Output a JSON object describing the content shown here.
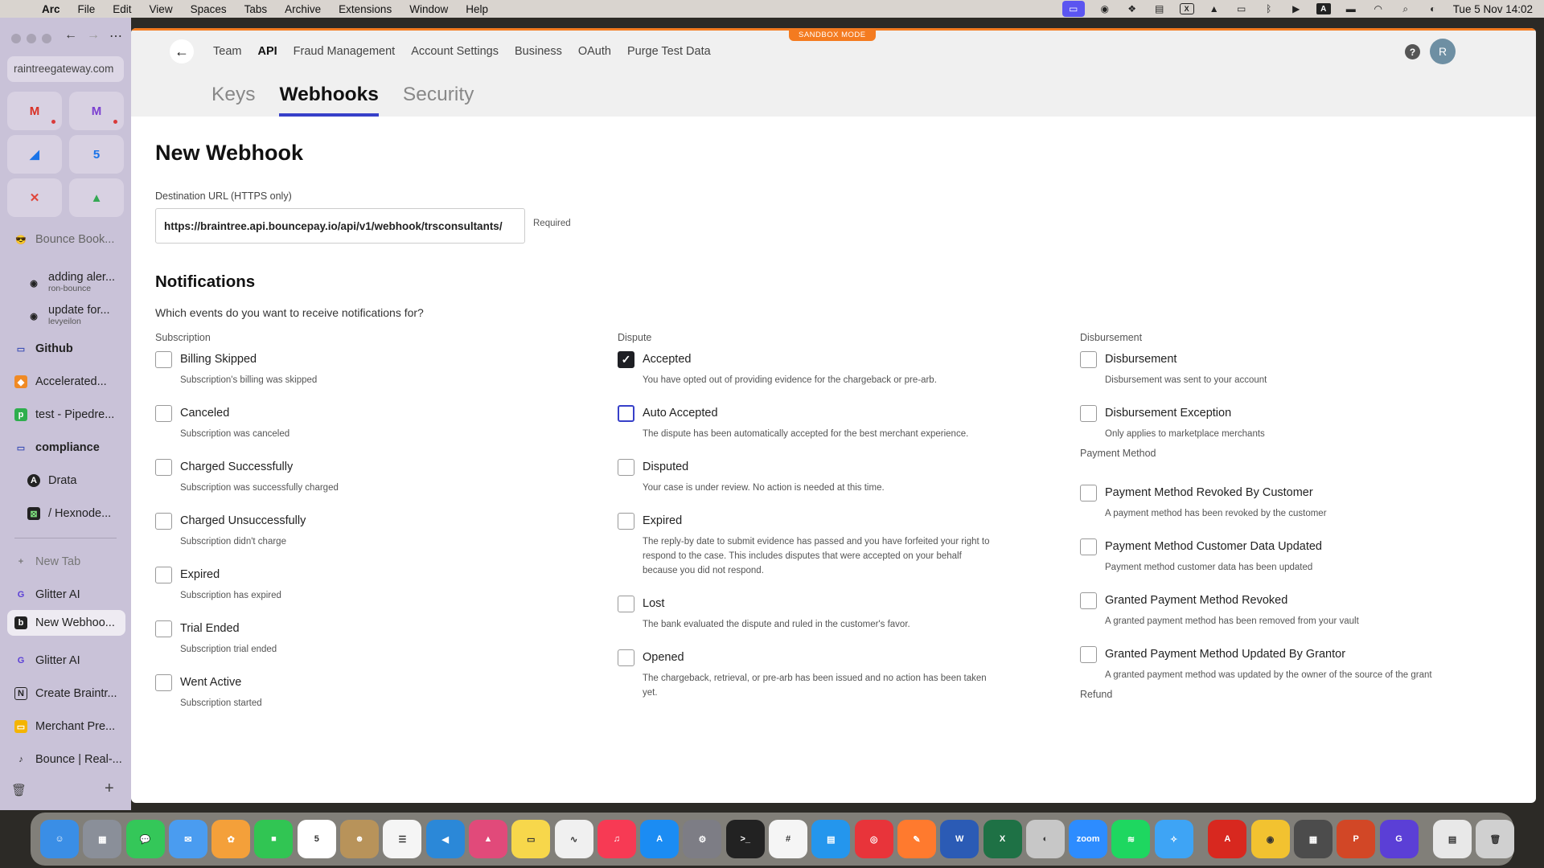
{
  "menubar": {
    "app": "Arc",
    "items": [
      "File",
      "Edit",
      "View",
      "Spaces",
      "Tabs",
      "Archive",
      "Extensions",
      "Window",
      "Help"
    ],
    "datetime": "Tue 5 Nov  14:02"
  },
  "sidebar": {
    "url": "raintreegateway.com",
    "favorites": [
      {
        "icon": "gmail-icon",
        "glyph": "M",
        "color": "#d93025"
      },
      {
        "icon": "gmail-icon",
        "glyph": "M",
        "color": "#7b3fd0"
      },
      {
        "icon": "drive-icon",
        "glyph": "◢",
        "color": "#1a73e8"
      },
      {
        "icon": "calendar-icon",
        "glyph": "5",
        "color": "#1a73e8"
      },
      {
        "icon": "close-x-icon",
        "glyph": "✕",
        "color": "#e0453a"
      },
      {
        "icon": "google-drive-icon",
        "glyph": "▲",
        "color": "#34a853"
      }
    ],
    "items": [
      {
        "label": "Bounce Book...",
        "kind": "muted"
      },
      {
        "label": "adding aler...",
        "sub": "ron-bounce"
      },
      {
        "label": "update for...",
        "sub": "levyeilon"
      },
      {
        "label": "Github"
      },
      {
        "label": "Accelerated..."
      },
      {
        "label": "test - Pipedre..."
      },
      {
        "label": "compliance"
      },
      {
        "label": "Drata"
      },
      {
        "label": "/ Hexnode..."
      },
      {
        "label": "New Tab"
      },
      {
        "label": "Glitter AI"
      },
      {
        "label": "New Webhoo..."
      },
      {
        "label": "Glitter AI"
      },
      {
        "label": "Create Braintr..."
      },
      {
        "label": "Merchant Pre..."
      },
      {
        "label": "Bounce | Real-..."
      }
    ]
  },
  "sandbox_label": "SANDBOX MODE",
  "topnav": {
    "links": [
      "Team",
      "API",
      "Fraud Management",
      "Account Settings",
      "Business",
      "OAuth",
      "Purge Test Data"
    ],
    "active": "API",
    "help": "?",
    "avatar": "R"
  },
  "subtabs": [
    "Keys",
    "Webhooks",
    "Security"
  ],
  "active_subtab": "Webhooks",
  "page": {
    "title": "New Webhook",
    "url_label": "Destination URL (HTTPS only)",
    "url_value": "https://braintree.api.bouncepay.io/api/v1/webhook/trsconsultants/",
    "required": "Required",
    "section_title": "Notifications",
    "section_desc": "Which events do you want to receive notifications for?"
  },
  "columns": [
    {
      "groups": [
        {
          "label": "Subscription",
          "events": [
            {
              "name": "Billing Skipped",
              "desc": "Subscription's billing was skipped",
              "checked": false
            },
            {
              "name": "Canceled",
              "desc": "Subscription was canceled",
              "checked": false
            },
            {
              "name": "Charged Successfully",
              "desc": "Subscription was successfully charged",
              "checked": false
            },
            {
              "name": "Charged Unsuccessfully",
              "desc": "Subscription didn't charge",
              "checked": false
            },
            {
              "name": "Expired",
              "desc": "Subscription has expired",
              "checked": false
            },
            {
              "name": "Trial Ended",
              "desc": "Subscription trial ended",
              "checked": false
            },
            {
              "name": "Went Active",
              "desc": "Subscription started",
              "checked": false
            }
          ]
        }
      ]
    },
    {
      "groups": [
        {
          "label": "Dispute",
          "events": [
            {
              "name": "Accepted",
              "desc": "You have opted out of providing evidence for the chargeback or pre-arb.",
              "checked": true
            },
            {
              "name": "Auto Accepted",
              "desc": "The dispute has been automatically accepted for the best merchant experience.",
              "checked": false,
              "focused": true
            },
            {
              "name": "Disputed",
              "desc": "Your case is under review. No action is needed at this time.",
              "checked": false
            },
            {
              "name": "Expired",
              "desc": "The reply-by date to submit evidence has passed and you have forfeited your right to respond to the case. This includes disputes that were accepted on your behalf because you did not respond.",
              "checked": false
            },
            {
              "name": "Lost",
              "desc": "The bank evaluated the dispute and ruled in the customer's favor.",
              "checked": false
            },
            {
              "name": "Opened",
              "desc": "The chargeback, retrieval, or pre-arb has been issued and no action has been taken yet.",
              "checked": false
            }
          ]
        }
      ]
    },
    {
      "groups": [
        {
          "label": "Disbursement",
          "events": [
            {
              "name": "Disbursement",
              "desc": "Disbursement was sent to your account",
              "checked": false
            },
            {
              "name": "Disbursement Exception",
              "desc": "Only applies to marketplace merchants",
              "checked": false
            }
          ]
        },
        {
          "label": "Payment Method",
          "events": [
            {
              "name": "Payment Method Revoked By Customer",
              "desc": "A payment method has been revoked by the customer",
              "checked": false
            },
            {
              "name": "Payment Method Customer Data Updated",
              "desc": "Payment method customer data has been updated",
              "checked": false
            },
            {
              "name": "Granted Payment Method Revoked",
              "desc": "A granted payment method has been removed from your vault",
              "checked": false
            },
            {
              "name": "Granted Payment Method Updated By Grantor",
              "desc": "A granted payment method was updated by the owner of the source of the grant",
              "checked": false
            }
          ]
        },
        {
          "label": "Refund",
          "events": []
        }
      ]
    }
  ],
  "dock": [
    {
      "name": "finder-icon",
      "glyph": "☺",
      "color": "#3a8ee6"
    },
    {
      "name": "launchpad-icon",
      "glyph": "▦",
      "color": "#8a8f99"
    },
    {
      "name": "messages-icon",
      "glyph": "💬",
      "color": "#34c759"
    },
    {
      "name": "mail-icon",
      "glyph": "✉",
      "color": "#4a9cf0"
    },
    {
      "name": "photos-icon",
      "glyph": "✿",
      "color": "#f4a03a"
    },
    {
      "name": "facetime-icon",
      "glyph": "■",
      "color": "#31c553"
    },
    {
      "name": "calendar-icon",
      "glyph": "5",
      "color": "#ffffff"
    },
    {
      "name": "contacts-icon",
      "glyph": "☻",
      "color": "#b8935a"
    },
    {
      "name": "reminders-icon",
      "glyph": "☰",
      "color": "#f5f5f5"
    },
    {
      "name": "vscode-icon",
      "glyph": "◀",
      "color": "#2b88d8"
    },
    {
      "name": "affinity-icon",
      "glyph": "▲",
      "color": "#e14a7a"
    },
    {
      "name": "notes-icon",
      "glyph": "▭",
      "color": "#f7d74b"
    },
    {
      "name": "freeform-icon",
      "glyph": "∿",
      "color": "#f0f0f0"
    },
    {
      "name": "music-icon",
      "glyph": "♫",
      "color": "#f73a54"
    },
    {
      "name": "appstore-icon",
      "glyph": "A",
      "color": "#1b8cf3"
    },
    {
      "name": "settings-icon",
      "glyph": "⚙",
      "color": "#7d7d85"
    },
    {
      "name": "terminal-icon",
      "glyph": ">_",
      "color": "#222222"
    },
    {
      "name": "slack-icon",
      "glyph": "#",
      "color": "#f5f5f5"
    },
    {
      "name": "docker-icon",
      "glyph": "▤",
      "color": "#2496ed"
    },
    {
      "name": "nord-icon",
      "glyph": "◎",
      "color": "#e8343a"
    },
    {
      "name": "pen-icon",
      "glyph": "✎",
      "color": "#ff7a2e"
    },
    {
      "name": "word-icon",
      "glyph": "W",
      "color": "#2b5bb5"
    },
    {
      "name": "excel-icon",
      "glyph": "X",
      "color": "#1e7145"
    },
    {
      "name": "cleaner-icon",
      "glyph": "◐",
      "color": "#c7c7c7"
    },
    {
      "name": "zoom-icon",
      "glyph": "zoom",
      "color": "#2d8cff"
    },
    {
      "name": "spotify-icon",
      "glyph": "≋",
      "color": "#1ed760"
    },
    {
      "name": "safari-icon",
      "glyph": "✧",
      "color": "#3ea4f5"
    },
    {
      "name": "acrobat-icon",
      "glyph": "A",
      "color": "#d8281f"
    },
    {
      "name": "chrome-icon",
      "glyph": "◉",
      "color": "#f2c230"
    },
    {
      "name": "calculator-icon",
      "glyph": "▦",
      "color": "#4c4c4c"
    },
    {
      "name": "powerpoint-icon",
      "glyph": "P",
      "color": "#d24726"
    },
    {
      "name": "glitter-icon",
      "glyph": "G",
      "color": "#5b3fd6"
    },
    {
      "name": "documents-icon",
      "glyph": "▤",
      "color": "#e8e8e8"
    },
    {
      "name": "trash-icon",
      "glyph": "🗑",
      "color": "#d0d0d0"
    }
  ]
}
